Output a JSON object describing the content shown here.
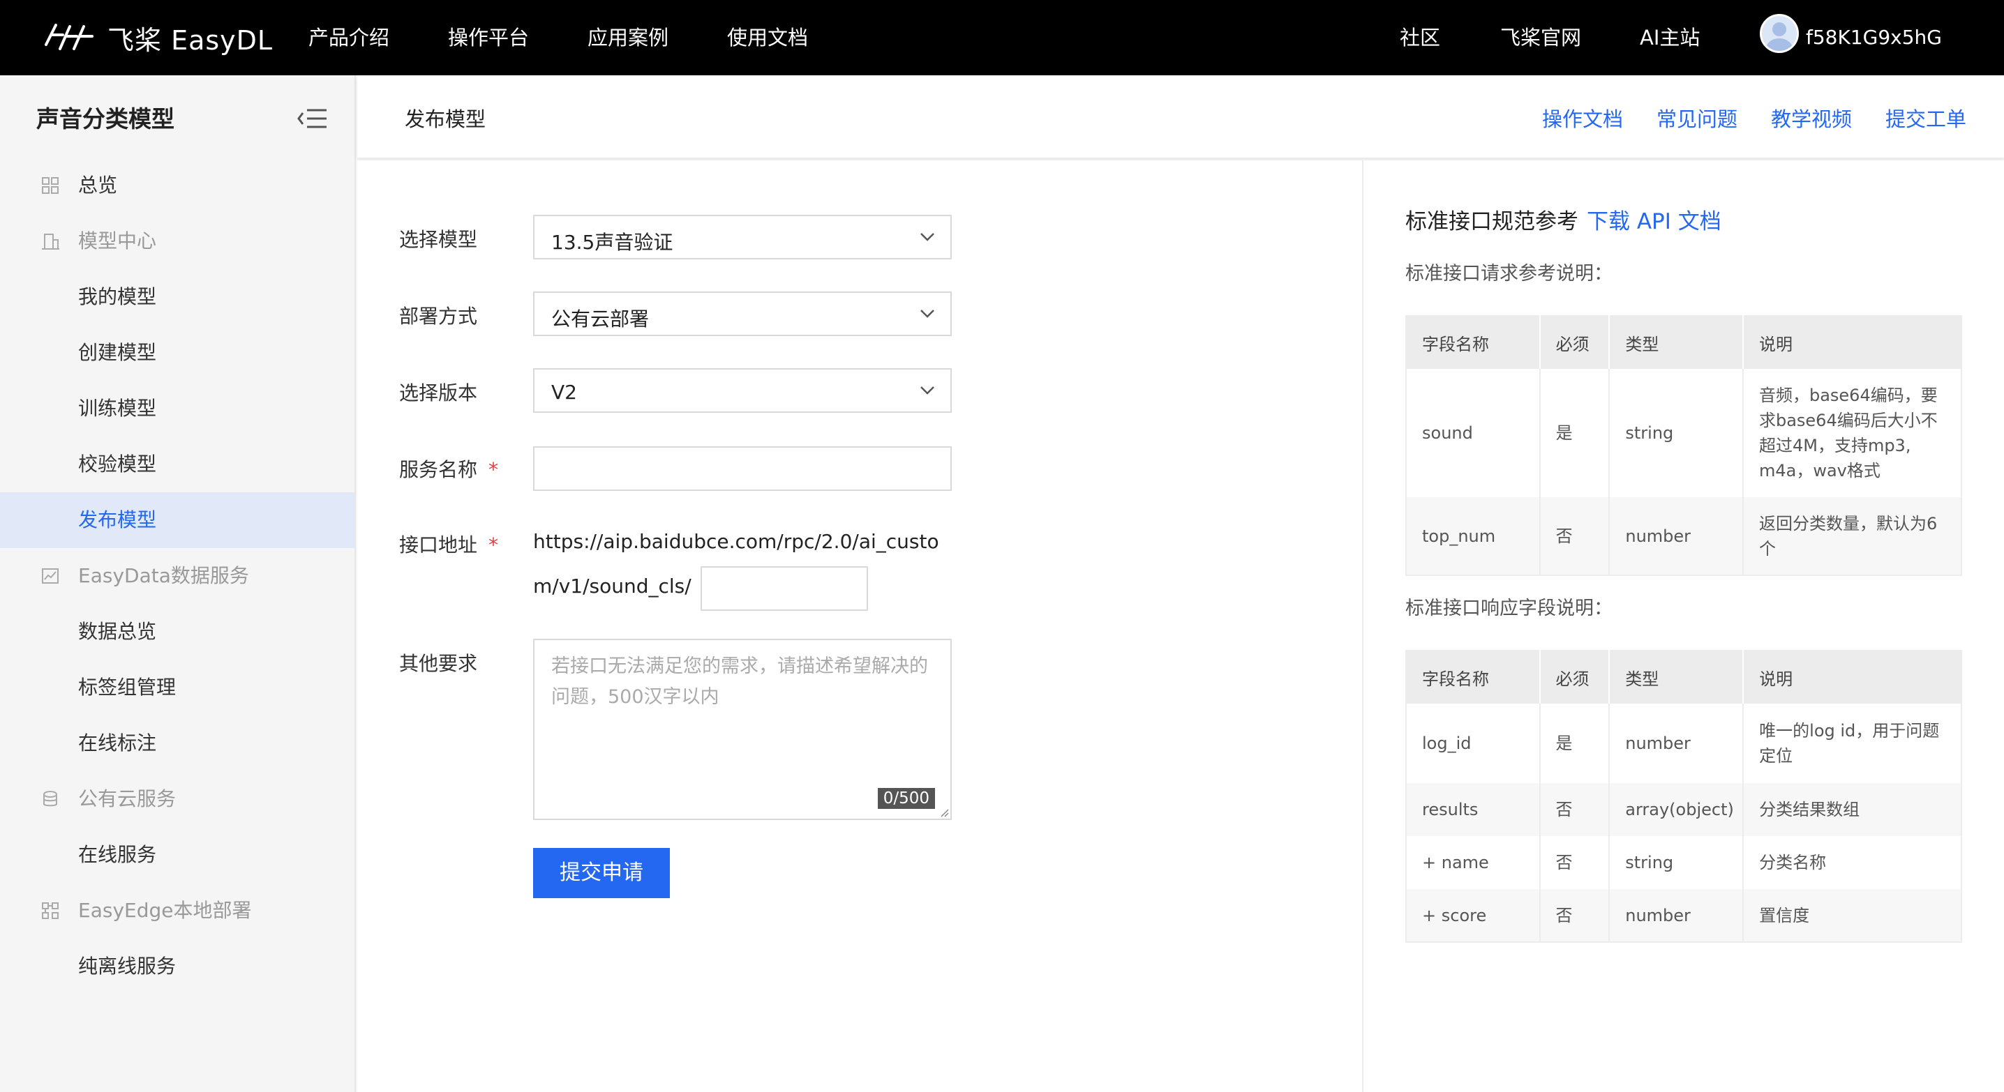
{
  "topnav": {
    "logo_text": "飞桨 EasyDL",
    "items": [
      "产品介绍",
      "操作平台",
      "应用案例",
      "使用文档"
    ],
    "right_items": [
      "社区",
      "飞桨官网",
      "AI主站"
    ],
    "username": "f58K1G9x5hG"
  },
  "sidebar": {
    "title": "声音分类模型",
    "items": [
      {
        "label": "总览",
        "type": "top",
        "icon": "grid-icon"
      },
      {
        "label": "模型中心",
        "type": "group",
        "icon": "building-icon"
      },
      {
        "label": "我的模型",
        "type": "child"
      },
      {
        "label": "创建模型",
        "type": "child"
      },
      {
        "label": "训练模型",
        "type": "child"
      },
      {
        "label": "校验模型",
        "type": "child"
      },
      {
        "label": "发布模型",
        "type": "child",
        "active": true
      },
      {
        "label": "EasyData数据服务",
        "type": "group",
        "icon": "chart-icon"
      },
      {
        "label": "数据总览",
        "type": "child"
      },
      {
        "label": "标签组管理",
        "type": "child"
      },
      {
        "label": "在线标注",
        "type": "child"
      },
      {
        "label": "公有云服务",
        "type": "group",
        "icon": "database-icon"
      },
      {
        "label": "在线服务",
        "type": "child"
      },
      {
        "label": "EasyEdge本地部署",
        "type": "group",
        "icon": "deploy-icon"
      },
      {
        "label": "纯离线服务",
        "type": "child"
      }
    ]
  },
  "header": {
    "title": "发布模型",
    "links": [
      "操作文档",
      "常见问题",
      "教学视频",
      "提交工单"
    ]
  },
  "form": {
    "model_label": "选择模型",
    "model_value": "13.5声音验证",
    "deploy_label": "部署方式",
    "deploy_value": "公有云部署",
    "version_label": "选择版本",
    "version_value": "V2",
    "service_label": "服务名称",
    "url_label": "接口地址",
    "url_line1": "https://aip.baidubce.com/rpc/2.0/ai_custo",
    "url_line2": "m/v1/sound_cls/",
    "other_label": "其他要求",
    "other_placeholder": "若接口无法满足您的需求，请描述希望解决的问题，500汉字以内",
    "counter": "0/500",
    "required_mark": "*",
    "submit_label": "提交申请"
  },
  "reference": {
    "title": "标准接口规范参考",
    "download_link": "下载 API 文档",
    "request_title": "标准接口请求参考说明：",
    "response_title": "标准接口响应字段说明：",
    "headers": [
      "字段名称",
      "必须",
      "类型",
      "说明"
    ],
    "request_rows": [
      [
        "sound",
        "是",
        "string",
        "音频，base64编码，要求base64编码后大小不超过4M，支持mp3, m4a，wav格式"
      ],
      [
        "top_num",
        "否",
        "number",
        "返回分类数量，默认为6个"
      ]
    ],
    "response_rows": [
      [
        "log_id",
        "是",
        "number",
        "唯一的log id，用于问题定位"
      ],
      [
        "results",
        "否",
        "array(object)",
        "分类结果数组"
      ],
      [
        "+ name",
        "否",
        "string",
        "分类名称"
      ],
      [
        "+ score",
        "否",
        "number",
        "置信度"
      ]
    ]
  },
  "colors": {
    "accent": "#2468f2",
    "topbar": "#000000",
    "sidebar_active_bg": "#e1e8f7",
    "required": "#e43f3f"
  }
}
